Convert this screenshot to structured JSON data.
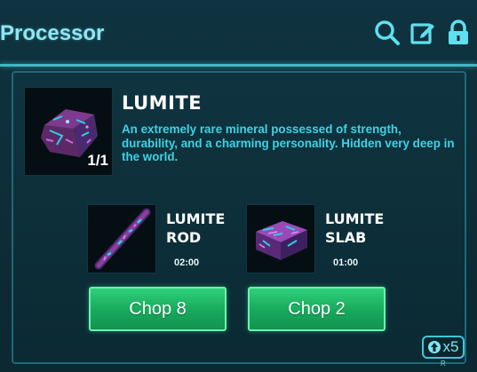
{
  "header": {
    "title": "Processor",
    "icons": [
      "search-icon",
      "edit-icon",
      "lock-icon"
    ]
  },
  "item": {
    "name": "LUMITE",
    "count": "1/1",
    "description": "An extremely rare mineral possessed of strength, durability, and a charming personality. Hidden very deep in the world."
  },
  "recipes": [
    {
      "name": "LUMITE ROD",
      "time": "02:00",
      "button": "Chop 8"
    },
    {
      "name": "LUMITE SLAB",
      "time": "01:00",
      "button": "Chop 2"
    }
  ],
  "multiplier": {
    "label": "x5",
    "key": "R"
  },
  "colors": {
    "accent": "#3fd2e4",
    "button": "#1fb865",
    "panel_border": "#1c6a78"
  }
}
